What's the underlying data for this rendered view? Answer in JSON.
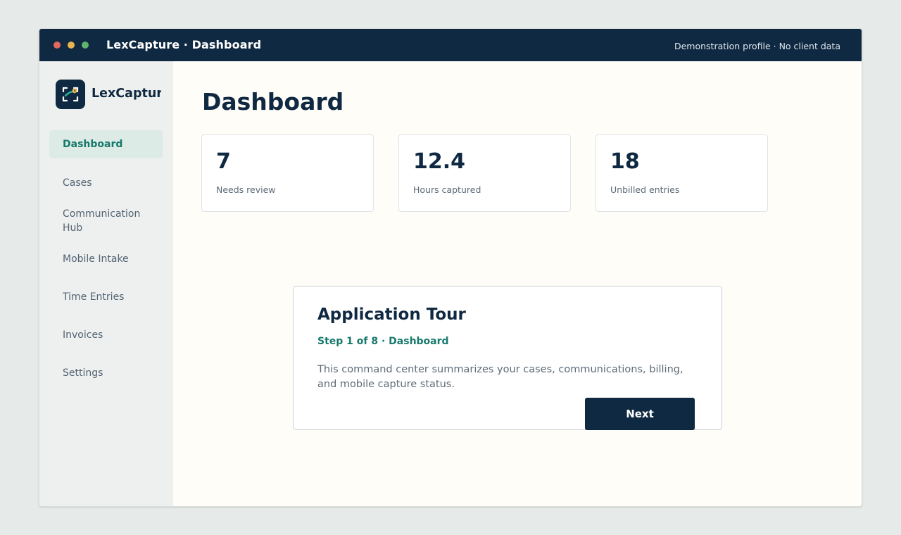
{
  "window": {
    "title": "LexCapture · Dashboard",
    "note": "Demonstration profile · No client data"
  },
  "sidebar": {
    "logo_text": "LexCapture",
    "items": [
      {
        "label": "Dashboard",
        "active": true
      },
      {
        "label": "Cases"
      },
      {
        "label": "Communication Hub"
      },
      {
        "label": "Mobile Intake"
      },
      {
        "label": "Time Entries"
      },
      {
        "label": "Invoices"
      },
      {
        "label": "Settings"
      }
    ]
  },
  "main": {
    "title": "Dashboard",
    "stats": [
      {
        "value": "7",
        "label": "Needs review"
      },
      {
        "value": "12.4",
        "label": "Hours captured"
      },
      {
        "value": "18",
        "label": "Unbilled entries"
      }
    ]
  },
  "tour": {
    "title": "Application Tour",
    "step": "Step 1 of 8 · Dashboard",
    "text": "This command center summarizes your cases, communications, billing, and mobile capture status.",
    "next_label": "Next"
  },
  "colors": {
    "navy": "#0f2942",
    "accent": "#17796b",
    "active_bg": "#dcebe6"
  },
  "icons": {
    "logo": "capture-frame-icon"
  }
}
